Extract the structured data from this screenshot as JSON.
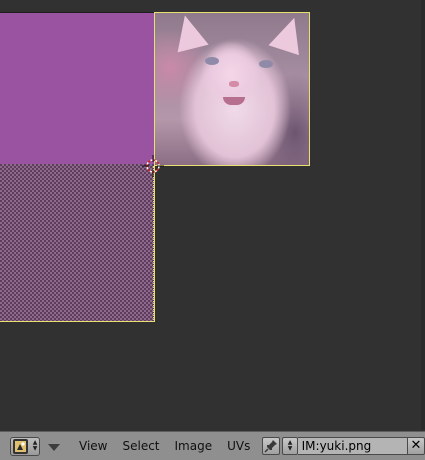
{
  "header": {
    "editor_type_icon": "uv-image-editor-icon",
    "menus": [
      "View",
      "Select",
      "Image",
      "UVs"
    ],
    "pin_icon": "pin-icon",
    "image_browse_icon": "image-browse-icon",
    "image_name": "IM:yuki.png",
    "close_label": "✕"
  },
  "viewport": {
    "background_color": "#313131",
    "uv_face_color": "#9a53a0",
    "selection_color": "#e8e070",
    "cursor_icon": "2d-cursor-icon"
  }
}
